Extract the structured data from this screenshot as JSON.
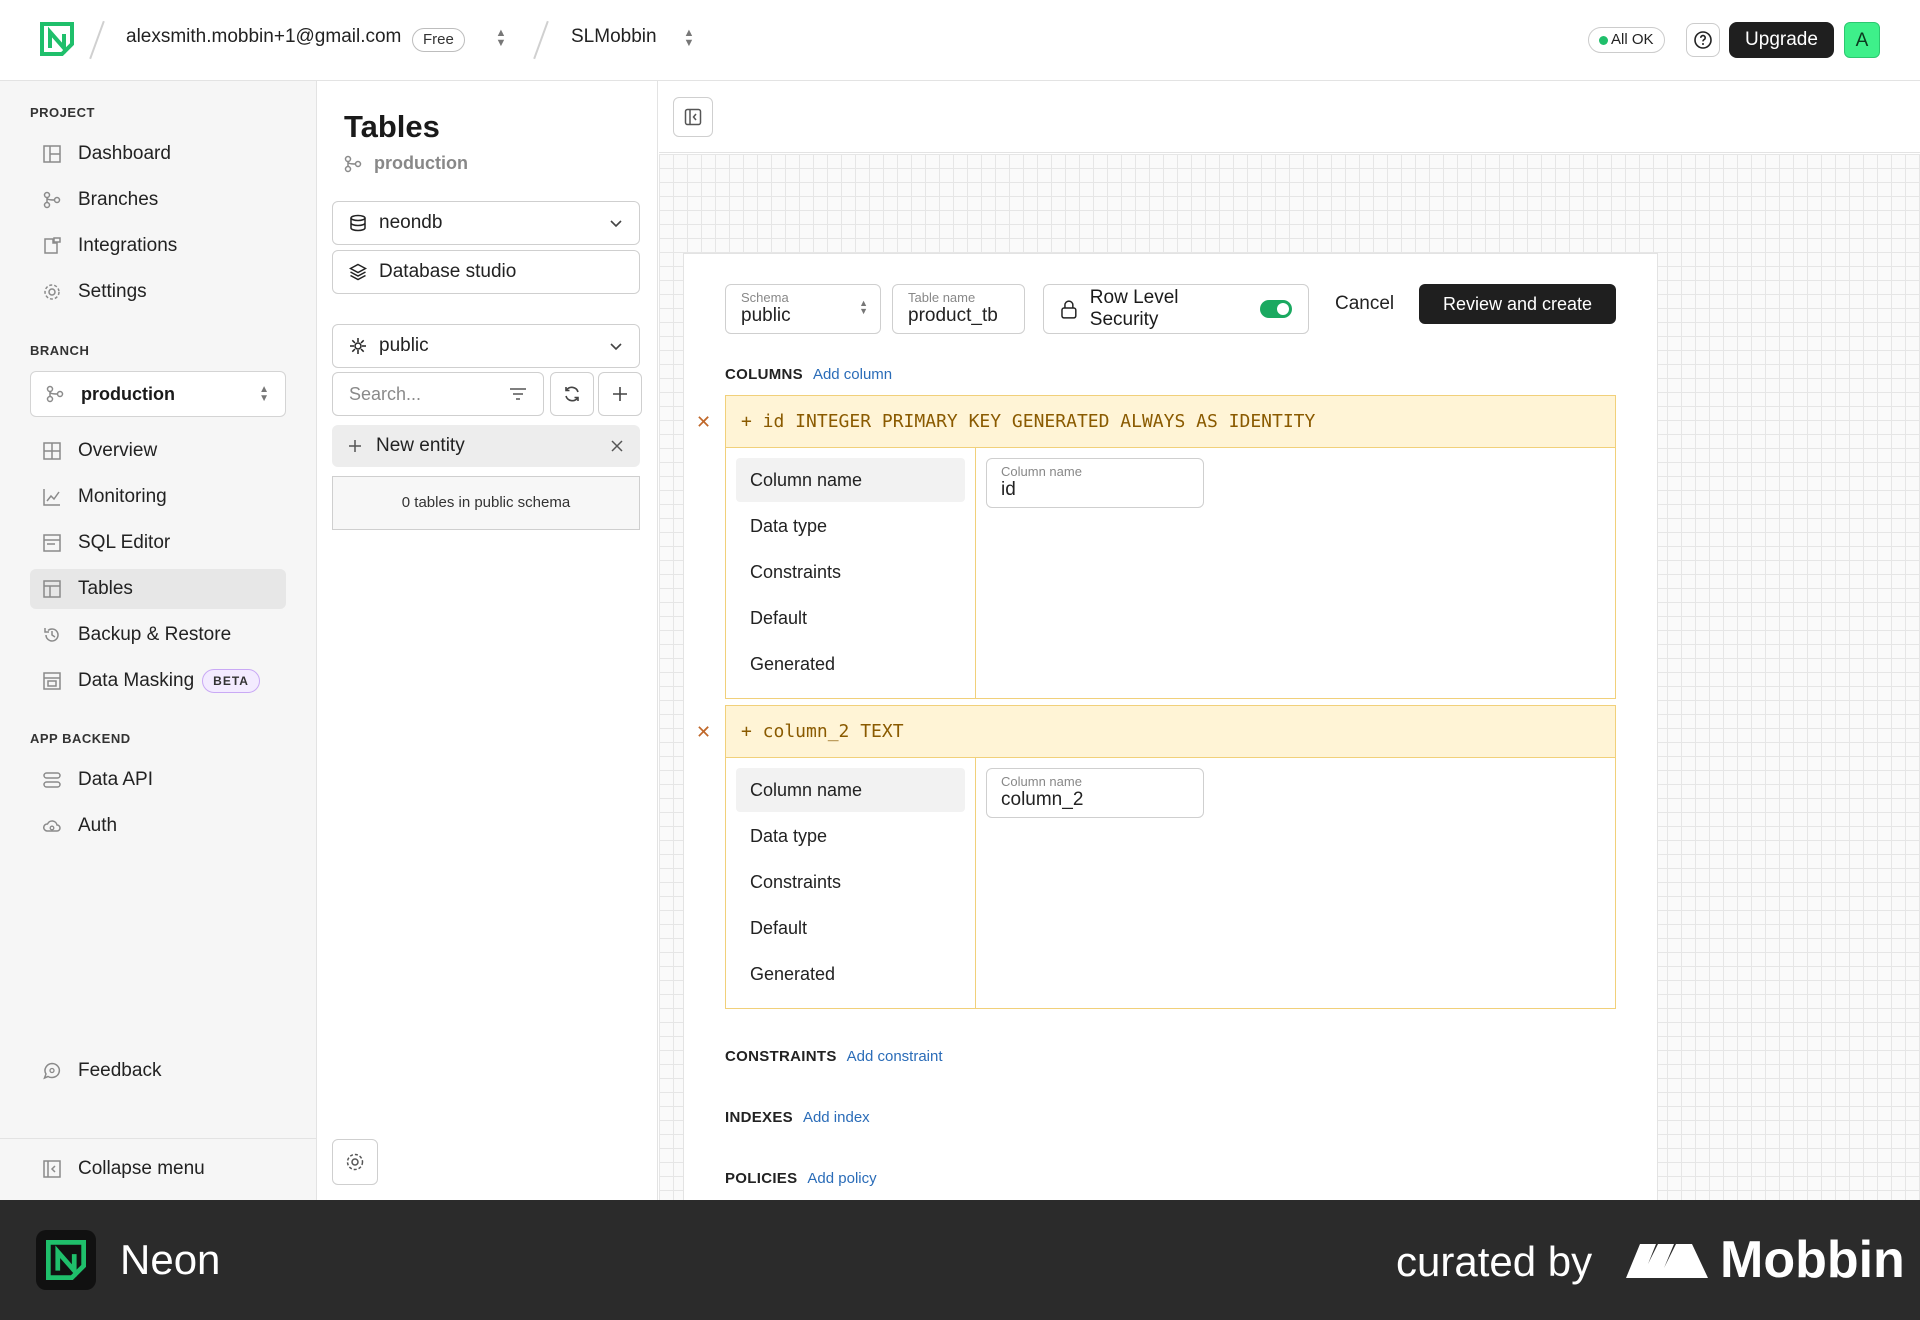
{
  "topbar": {
    "account_email": "alexsmith.mobbin+1@gmail.com",
    "plan_badge": "Free",
    "project_name": "SLMobbin",
    "status_label": "All OK",
    "help_icon": "question-circle-icon",
    "upgrade_label": "Upgrade",
    "avatar_initial": "A"
  },
  "sidebar": {
    "project_section": "PROJECT",
    "project_items": [
      {
        "label": "Dashboard",
        "icon": "dashboard-icon"
      },
      {
        "label": "Branches",
        "icon": "branches-icon"
      },
      {
        "label": "Integrations",
        "icon": "integrations-icon"
      },
      {
        "label": "Settings",
        "icon": "gear-icon"
      }
    ],
    "branch_section": "BRANCH",
    "branch_selected": "production",
    "branch_items": [
      {
        "label": "Overview",
        "icon": "overview-icon"
      },
      {
        "label": "Monitoring",
        "icon": "chart-line-icon"
      },
      {
        "label": "SQL Editor",
        "icon": "sql-editor-icon"
      },
      {
        "label": "Tables",
        "icon": "table-icon",
        "active": true
      },
      {
        "label": "Backup & Restore",
        "icon": "history-icon"
      },
      {
        "label": "Data Masking",
        "icon": "masking-icon",
        "badge": "BETA"
      }
    ],
    "app_section": "APP BACKEND",
    "app_items": [
      {
        "label": "Data API",
        "icon": "data-api-icon"
      },
      {
        "label": "Auth",
        "icon": "auth-cloud-icon"
      }
    ],
    "feedback_label": "Feedback",
    "collapse_label": "Collapse menu"
  },
  "tables_panel": {
    "title": "Tables",
    "branch": "production",
    "database": "neondb",
    "studio_label": "Database studio",
    "schema": "public",
    "search_placeholder": "Search...",
    "new_entity_label": "New entity",
    "empty_note": "0 tables in public schema"
  },
  "editor": {
    "schema_label": "Schema",
    "schema_value": "public",
    "table_name_label": "Table name",
    "table_name_value": "product_tb",
    "rls_label": "Row Level Security",
    "rls_enabled": true,
    "cancel_label": "Cancel",
    "review_label": "Review and create",
    "columns_title": "COLUMNS",
    "add_column": "Add column",
    "columns": [
      {
        "definition": "+ id INTEGER PRIMARY KEY GENERATED ALWAYS AS IDENTITY",
        "menu": [
          "Column name",
          "Data type",
          "Constraints",
          "Default",
          "Generated"
        ],
        "field_label": "Column name",
        "field_value": "id"
      },
      {
        "definition": "+ column_2 TEXT",
        "menu": [
          "Column name",
          "Data type",
          "Constraints",
          "Default",
          "Generated"
        ],
        "field_label": "Column name",
        "field_value": "column_2"
      }
    ],
    "constraints_title": "CONSTRAINTS",
    "add_constraint": "Add constraint",
    "indexes_title": "INDEXES",
    "add_index": "Add index",
    "policies_title": "POLICIES",
    "add_policy": "Add policy"
  },
  "footer": {
    "app_name": "Neon",
    "curated_by": "curated by",
    "brand": "Mobbin"
  },
  "colors": {
    "accent_green": "#1aa960",
    "column_header_bg": "#fff4d6",
    "link_blue": "#2a6cb8"
  }
}
